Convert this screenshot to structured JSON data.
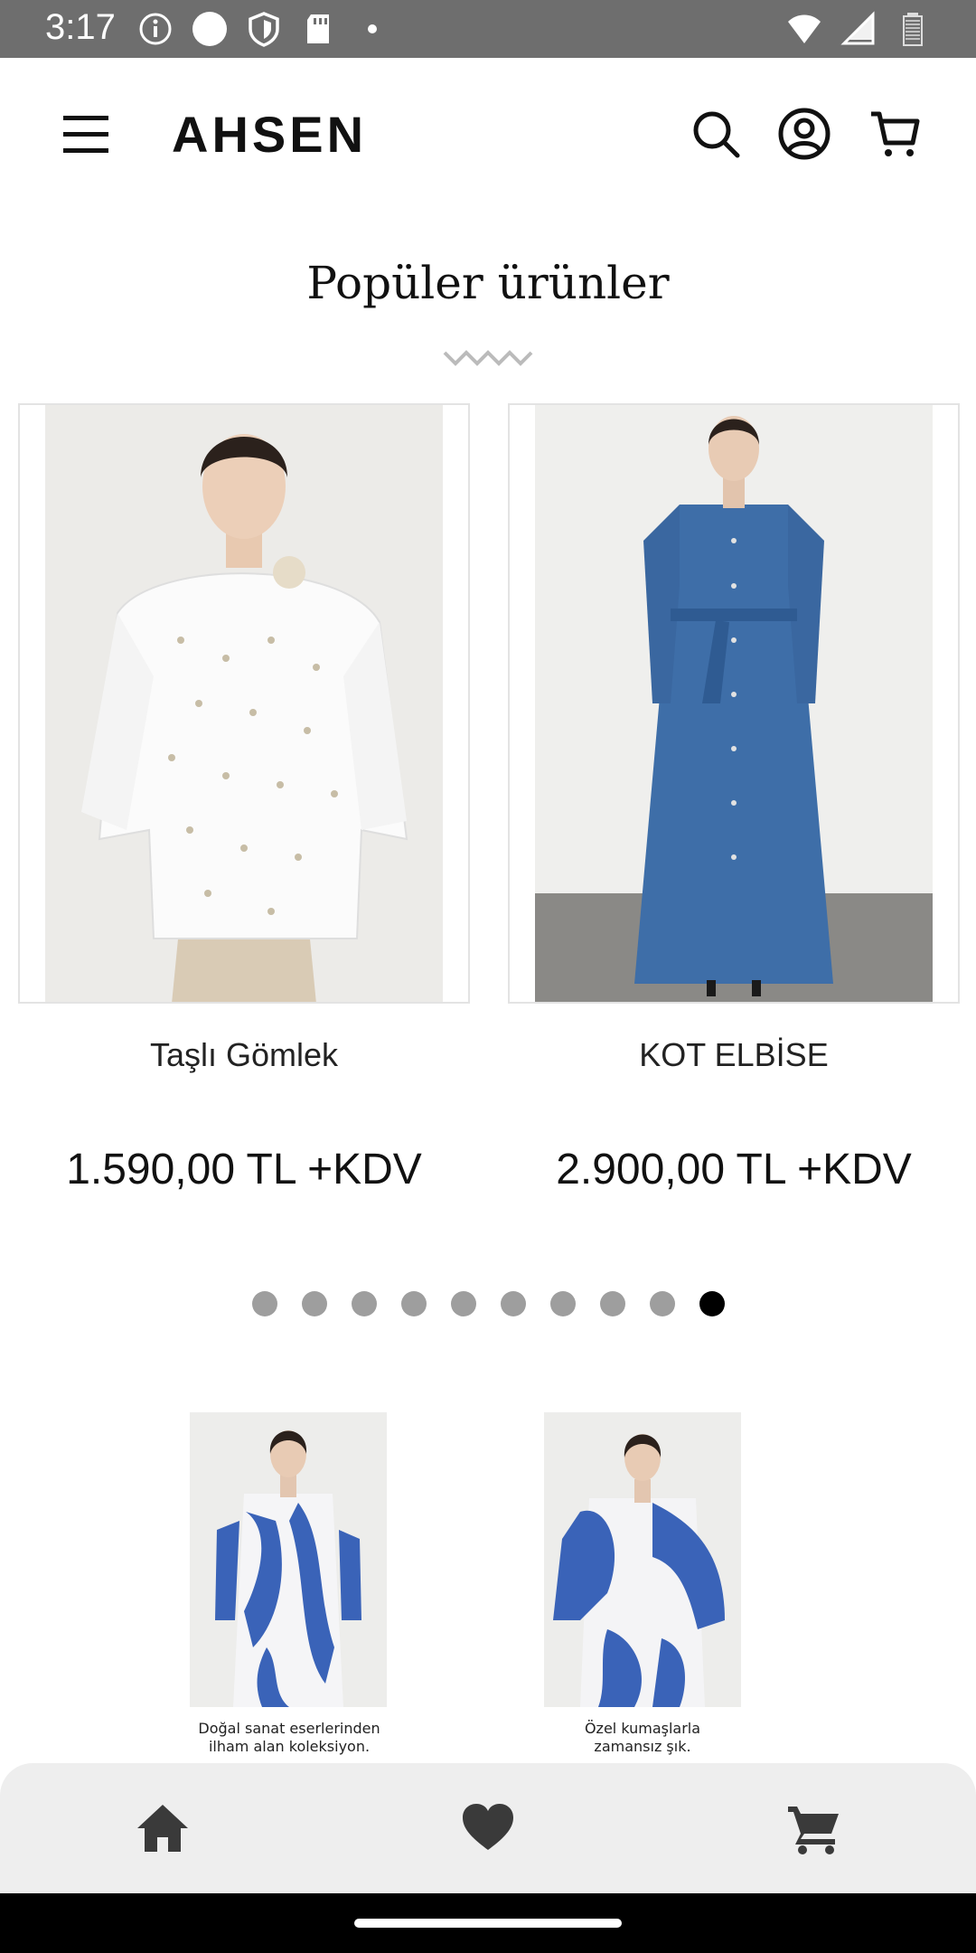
{
  "status_bar": {
    "time": "3:17",
    "left_icons": [
      "info-icon",
      "circle-icon",
      "shield-icon",
      "sd-card-icon",
      "dot-icon"
    ],
    "right_icons": [
      "wifi-icon",
      "signal-icon",
      "battery-icon"
    ]
  },
  "header": {
    "logo": "AHSEN",
    "icons": [
      "menu-icon",
      "search-icon",
      "account-icon",
      "cart-icon"
    ]
  },
  "section": {
    "title": "Popüler ürünler"
  },
  "products": [
    {
      "name": "Taşlı Gömlek",
      "price": "1.590,00 TL +KDV"
    },
    {
      "name": "KOT ELBİSE",
      "price": "2.900,00 TL +KDV"
    }
  ],
  "carousel": {
    "total": 10,
    "active_index": 9
  },
  "banners": [
    {
      "caption_line1": "Doğal sanat eserlerinden",
      "caption_line2": "ilham alan koleksiyon."
    },
    {
      "caption_line1": "Özel kumaşlarla",
      "caption_line2": "zamansız şık."
    }
  ],
  "bottom_nav": [
    "home-icon",
    "heart-icon",
    "cart-icon"
  ],
  "colors": {
    "status_bar": "#6e6e6e",
    "dot_active": "#000000",
    "dot_inactive": "#9e9e9e",
    "nav_bg": "#eeeeee"
  }
}
